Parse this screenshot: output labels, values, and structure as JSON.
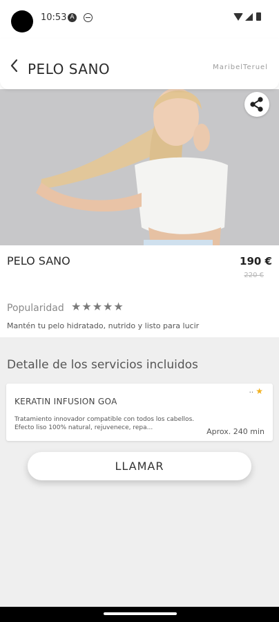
{
  "status_bar": {
    "time": "10:53",
    "icons": [
      "a-icon",
      "minus-circle-icon",
      "wifi-icon",
      "signal-icon",
      "battery-icon"
    ]
  },
  "header": {
    "title": "PELO SANO",
    "brand": "MaribelTeruel"
  },
  "product": {
    "name": "PELO SANO",
    "price": "190 €",
    "old_price": "220 €",
    "popularity_label": "Popularidad",
    "stars": "★★★★★",
    "rating": 5,
    "description": "Mantén tu pelo hidratado, nutrido y listo para lucir"
  },
  "services": {
    "section_title": "Detalle de los servicios incluidos",
    "items": [
      {
        "name": "KERATIN INFUSION GOA",
        "dots": "..",
        "star": "★",
        "description": "Tratamiento innovador compatible con todos los cabellos. Efecto liso 100% natural, rejuvenece, repa...",
        "duration": "Aprox. 240 min"
      }
    ]
  },
  "actions": {
    "call_label": "LLAMAR"
  },
  "colors": {
    "accent_star": "#f2b01e",
    "background_lower": "#efefef"
  }
}
